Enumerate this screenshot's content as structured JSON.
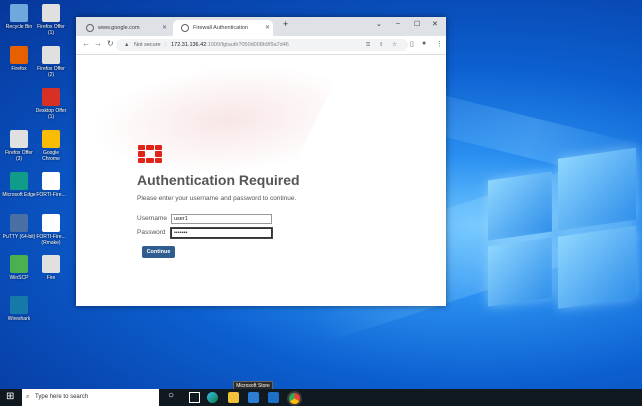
{
  "desktop": {
    "icons": [
      {
        "label": "Recycle Bin",
        "color": "#6fa8dc"
      },
      {
        "label": "Firefox Offer (1)",
        "color": "#e0e0e0"
      },
      {
        "label": "Firefox",
        "color": "#e66000"
      },
      {
        "label": "Firefox Offer (2)",
        "color": "#e0e0e0"
      },
      {
        "label": "Desktop Offer (1)",
        "color": "#d93025"
      },
      {
        "label": "Firefox Offer (3)",
        "color": "#e0e0e0"
      },
      {
        "label": "Google Chrome",
        "color": "#fbbc05"
      },
      {
        "label": "Microsoft Edge",
        "color": "#0f9d8a"
      },
      {
        "label": "FORTI-Fire...",
        "color": "#ffffff"
      },
      {
        "label": "PuTTY (64-bit)",
        "color": "#4a6fa5"
      },
      {
        "label": "FORTI-Fire... (Rmake)",
        "color": "#ffffff"
      },
      {
        "label": "WinSCP",
        "color": "#4caf50"
      },
      {
        "label": "Fire",
        "color": "#e0e0e0"
      },
      {
        "label": "Wireshark",
        "color": "#1679a7"
      }
    ]
  },
  "browser": {
    "tabs": [
      {
        "title": "www.google.com",
        "active": false
      },
      {
        "title": "Firewall Authentication",
        "active": true
      }
    ],
    "new_tab": "+",
    "window_controls": {
      "menu": "⌄",
      "minimize": "–",
      "maximize": "☐",
      "close": "✕"
    },
    "nav": {
      "back": "←",
      "forward": "→",
      "reload": "↻"
    },
    "security_label": "Not secure",
    "url_host": "172.31.136.42",
    "url_rest": ":1000/fgtauth?050d008b9f9a7d46",
    "toolbar_icons": {
      "key": "⚿",
      "share": "⇪",
      "star": "☆",
      "sidebar": "▯",
      "profile": "●",
      "menu": "⋮"
    }
  },
  "page": {
    "title": "Authentication Required",
    "subtitle": "Please enter your username and password to continue.",
    "username_label": "Username",
    "username_value": "user1",
    "password_label": "Password",
    "password_value": "•••••••",
    "continue_label": "Continue",
    "brand_color": "#e2231a",
    "button_color": "#2f5d8f"
  },
  "taskbar": {
    "start": "⊞",
    "search_placeholder": "Type here to search",
    "tooltip": "Microsoft Store",
    "apps": [
      "task-view",
      "edge",
      "file-explorer",
      "store",
      "mail",
      "chrome"
    ]
  }
}
